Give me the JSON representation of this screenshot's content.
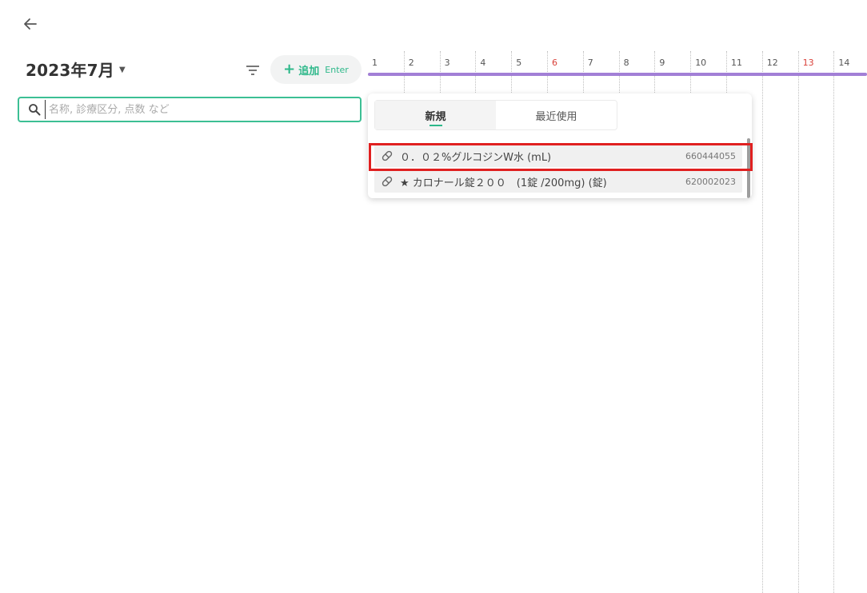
{
  "header": {
    "month_title": "2023年7月",
    "add_label": "追加",
    "add_shortcut": "Enter"
  },
  "search": {
    "placeholder": "名称, 診療区分, 点数 など",
    "value": ""
  },
  "timeline": {
    "days": [
      "1",
      "2",
      "3",
      "4",
      "5",
      "6",
      "7",
      "8",
      "9",
      "10",
      "11",
      "12",
      "13",
      "14"
    ],
    "holiday_days": [
      "6",
      "13"
    ],
    "bar_color": "#a27fd6"
  },
  "dropdown": {
    "tabs": [
      {
        "label": "新規",
        "active": true
      },
      {
        "label": "最近使用",
        "active": false
      }
    ],
    "items": [
      {
        "name": "０．０２%グルコジンW水 (mL)",
        "code": "660444055",
        "icon": "pill-icon",
        "highlighted": true
      },
      {
        "name": "★ カロナール錠２００　(1錠 /200mg)  (錠)",
        "code": "620002023",
        "icon": "pill-icon",
        "highlighted": false
      }
    ]
  },
  "colors": {
    "accent": "#2db88a",
    "highlight": "#e02020",
    "holiday": "#d9413a"
  }
}
